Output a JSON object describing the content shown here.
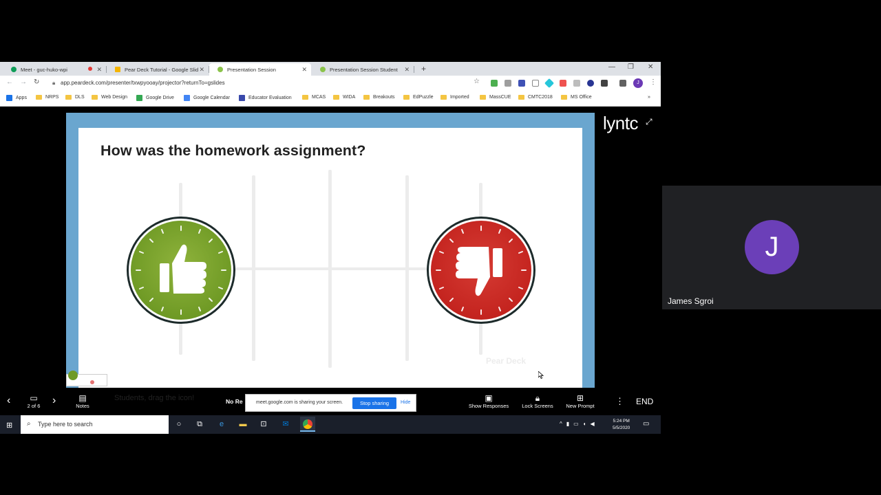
{
  "browser": {
    "tabs": [
      {
        "label": "Meet - guc-huko-wpi",
        "color": "#0f9d58"
      },
      {
        "label": "Pear Deck Tutorial - Google Slid",
        "color": "#f4b400"
      },
      {
        "label": "Presentation Session",
        "color": "#8bc34a"
      },
      {
        "label": "Presentation Session Student",
        "color": "#8bc34a"
      }
    ],
    "new_tab": "+",
    "url": "app.peardeck.com/presenter/txwpyooay/projector?returnTo=gslides",
    "bookmarks": [
      "Apps",
      "NRPS",
      "DLS",
      "Web Design",
      "Google Drive",
      "Google Calendar",
      "Educator Evaluation",
      "MCAS",
      "WIDA",
      "Breakouts",
      "EdPuzzle",
      "Imported",
      "MassCUE",
      "CMTC2018",
      "MS Office"
    ],
    "more": "»"
  },
  "slide": {
    "title": "How was the homework assignment?",
    "watermark": "Pear Deck"
  },
  "overlay": {
    "brand": "lyntc",
    "expand_icon": "⤢"
  },
  "participant": {
    "initial": "J",
    "name": "James Sgroi",
    "avatar_color": "#6b3fb8"
  },
  "controls": {
    "slide_counter": "2 of 6",
    "notes": "Notes",
    "student_hint": "Students, drag the icon!",
    "no_responses": "No Re",
    "show_responses": "Show Responses",
    "lock_screens": "Lock Screens",
    "new_prompt": "New Prompt",
    "end": "END"
  },
  "share_notice": {
    "text": "meet.google.com is sharing your screen.",
    "stop": "Stop sharing",
    "hide": "Hide"
  },
  "taskbar": {
    "search_placeholder": "Type here to search",
    "time": "5:24 PM",
    "date": "5/5/2020",
    "notifications": "2"
  }
}
